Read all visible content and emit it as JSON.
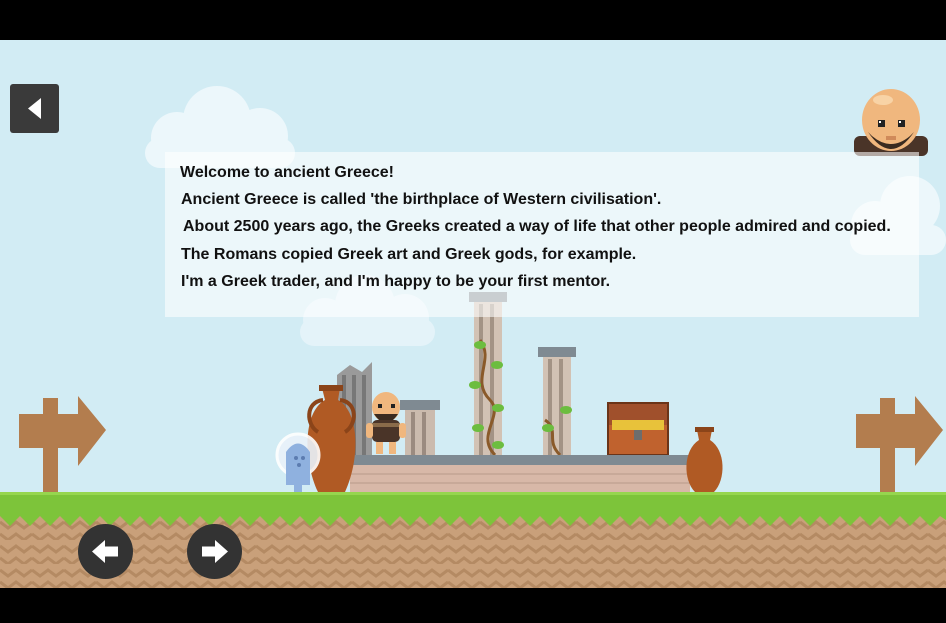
{
  "dialog": {
    "lines": [
      "Welcome to ancient Greece!",
      "Ancient Greece is called 'the birthplace of Western civilisation'.",
      "About 2500 years ago, the Greeks created a way of life that other people admired and copied.",
      "The Romans copied Greek art and Greek gods, for example.",
      "I'm a Greek trader, and I'm happy to be your first mentor."
    ]
  },
  "colors": {
    "sky": "#d2ecf4",
    "grass": "#7dc43a",
    "dirt": "#c9a07a",
    "button": "#333333",
    "signpost": "#b37d4e"
  },
  "icons": {
    "back": "triangle-left-icon",
    "move_left": "arrow-left-icon",
    "move_right": "arrow-right-icon"
  }
}
